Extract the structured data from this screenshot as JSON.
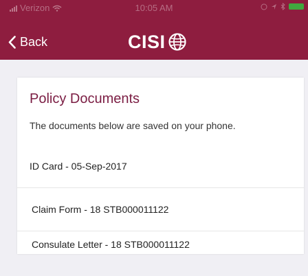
{
  "colors": {
    "brand": "#8e1d3f",
    "title": "#7b1d43"
  },
  "status_bar": {
    "carrier": "Verizon",
    "time": "10:05 AM",
    "icons": [
      "signal-icon",
      "wifi-icon",
      "alarm-icon",
      "location-icon",
      "bluetooth-icon",
      "battery-icon"
    ]
  },
  "nav": {
    "back_label": "Back",
    "logo_text": "CISI"
  },
  "card": {
    "title": "Policy Documents",
    "subtitle": "The documents below are saved on your phone.",
    "documents": [
      {
        "label": "ID Card - 05-Sep-2017"
      },
      {
        "label": "Claim Form - 18 STB000011122"
      },
      {
        "label": "Consulate Letter - 18 STB000011122"
      }
    ]
  }
}
